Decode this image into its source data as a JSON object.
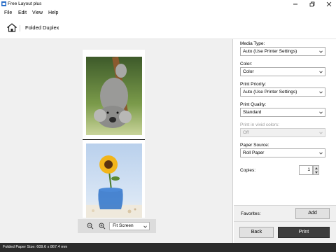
{
  "window": {
    "title": "Free Layout plus",
    "icon": "printer-app-icon",
    "controls": [
      "minimize-icon",
      "maximize-icon",
      "close-icon"
    ]
  },
  "menu": [
    {
      "label": "File"
    },
    {
      "label": "Edit"
    },
    {
      "label": "View"
    },
    {
      "label": "Help"
    }
  ],
  "toolbar": {
    "home_icon": "home-icon",
    "title": "Folded Duplex"
  },
  "preview": {
    "images": [
      {
        "description_icon": "koala-photo"
      },
      {
        "description_icon": "sunflower-vase-photo"
      }
    ],
    "zoom": {
      "zoom_out_icon": "zoom-out-icon",
      "zoom_in_icon": "zoom-in-icon",
      "fit_value": "Fit Screen"
    }
  },
  "settings": {
    "media_type": {
      "label": "Media Type:",
      "value": "Auto (Use Printer Settings)"
    },
    "color": {
      "label": "Color:",
      "value": "Color"
    },
    "print_priority": {
      "label": "Print Priority:",
      "value": "Auto (Use Printer Settings)"
    },
    "print_quality": {
      "label": "Print Quality:",
      "value": "Standard"
    },
    "vivid": {
      "label": "Print in vivid colors:",
      "value": "Off",
      "disabled": true
    },
    "paper_source": {
      "label": "Paper Source:",
      "value": "Roll Paper"
    },
    "copies": {
      "label": "Copies:",
      "value": "1"
    }
  },
  "favorites": {
    "label": "Favorites:",
    "add_label": "Add"
  },
  "actions": {
    "back_label": "Back",
    "print_label": "Print"
  },
  "status": {
    "text": "Folded Paper Size: 609.6 x 867.4 mm"
  },
  "colors": {
    "print_button": "#3d3d3d",
    "statusbar": "#2b2b2b",
    "preview_bg": "#f0f0f0"
  }
}
